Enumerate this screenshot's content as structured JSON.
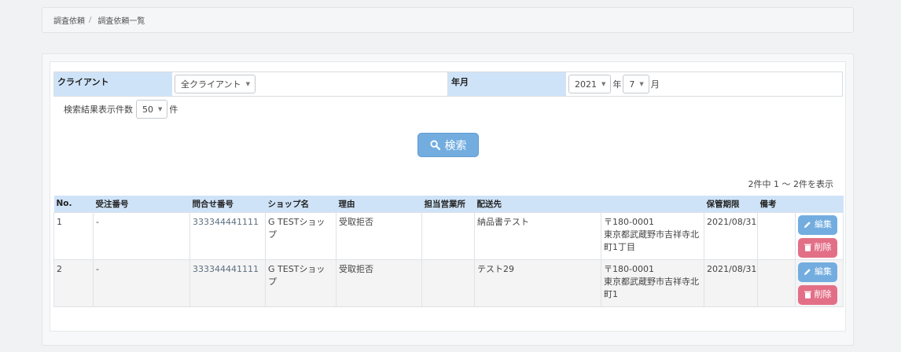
{
  "breadcrumb": {
    "items": [
      "調査依頼",
      "調査依頼一覧"
    ],
    "separator": "/"
  },
  "filters": {
    "client_label": "クライアント",
    "client_value": "全クライアント",
    "yearmonth_label": "年月",
    "year_value": "2021",
    "year_suffix": "年",
    "month_value": "7",
    "month_suffix": "月",
    "perpage_label": "検索結果表示件数",
    "perpage_value": "50",
    "perpage_suffix": "件"
  },
  "search": {
    "label": "検索",
    "icon": "search-icon"
  },
  "result_summary": "2件中 1 ～ 2件を表示",
  "table": {
    "headers": [
      "No.",
      "受注番号",
      "問合せ番号",
      "ショップ名",
      "理由",
      "担当営業所",
      "配送先",
      "保管期限",
      "備考"
    ],
    "rows": [
      {
        "no": "1",
        "order": "-",
        "inquiry": "333344441111",
        "shop": "G TESTショップ",
        "reason": "受取拒否",
        "office": "",
        "dest_name": "納品書テスト",
        "postal": "〒180-0001",
        "address": "東京都武蔵野市吉祥寺北町1丁目",
        "expiry": "2021/08/31",
        "note": "",
        "edit_label": "編集",
        "delete_label": "削除"
      },
      {
        "no": "2",
        "order": "-",
        "inquiry": "333344441111",
        "shop": "G TESTショップ",
        "reason": "受取拒否",
        "office": "",
        "dest_name": "テスト29",
        "postal": "〒180-0001",
        "address": "東京都武蔵野市吉祥寺北町1",
        "expiry": "2021/08/31",
        "note": "",
        "edit_label": "編集",
        "delete_label": "削除"
      }
    ]
  },
  "colors": {
    "header_bg": "#cfe3f8",
    "primary_button": "#73ade0",
    "danger_button": "#e36f87",
    "page_bg": "#f1f2f4"
  }
}
